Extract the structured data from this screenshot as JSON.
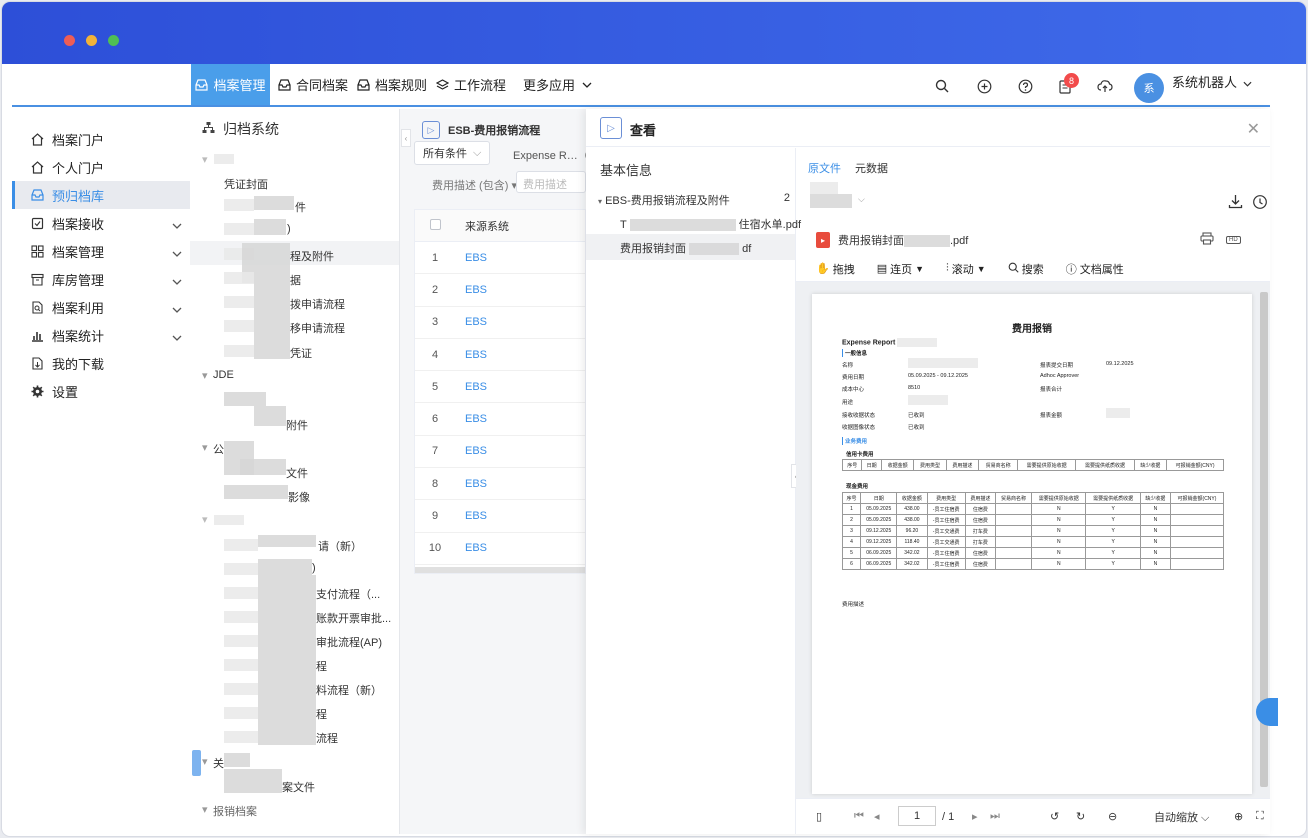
{
  "nav": {
    "items": [
      {
        "label": "档案管理",
        "icon": "inbox-icon",
        "active": true
      },
      {
        "label": "合同档案",
        "icon": "inbox-icon",
        "active": false
      },
      {
        "label": "档案规则",
        "icon": "inbox-icon",
        "active": false
      },
      {
        "label": "工作流程",
        "icon": "layers-icon",
        "active": false
      },
      {
        "label": "更多应用",
        "icon": "chevron-down-icon",
        "active": false
      }
    ],
    "badge_count": "8",
    "avatar_text": "系",
    "username": "系统机器人"
  },
  "sidebar": {
    "items": [
      {
        "label": "档案门户",
        "icon": "home-icon"
      },
      {
        "label": "个人门户",
        "icon": "home-icon"
      },
      {
        "label": "预归档库",
        "icon": "inbox-icon"
      },
      {
        "label": "档案接收",
        "icon": "receive-icon"
      },
      {
        "label": "档案管理",
        "icon": "grid-icon"
      },
      {
        "label": "库房管理",
        "icon": "archive-icon"
      },
      {
        "label": "档案利用",
        "icon": "file-search-icon"
      },
      {
        "label": "档案统计",
        "icon": "bar-chart-icon"
      },
      {
        "label": "我的下载",
        "icon": "download-icon"
      },
      {
        "label": "设置",
        "icon": "gear-icon"
      }
    ]
  },
  "tree": {
    "title": "归档系统",
    "nodes": [
      {
        "text": "凭证封面"
      },
      {
        "text": "件"
      },
      {
        "text": ")"
      },
      {
        "text": "程及附件"
      },
      {
        "text": "据"
      },
      {
        "text": "拨申请流程"
      },
      {
        "text": "移申请流程"
      },
      {
        "text": "凭证"
      },
      {
        "text": "JDE"
      },
      {
        "text": "附件"
      },
      {
        "text": "公"
      },
      {
        "text": "文件"
      },
      {
        "text": "影像"
      },
      {
        "text": "请（新）"
      },
      {
        "text": ")"
      },
      {
        "text": "支付流程（..."
      },
      {
        "text": "账款开票审批..."
      },
      {
        "text": "审批流程(AP)"
      },
      {
        "text": "程"
      },
      {
        "text": "料流程（新）"
      },
      {
        "text": "程"
      },
      {
        "text": "流程"
      },
      {
        "text": "关"
      },
      {
        "text": "案文件"
      },
      {
        "text": "报销档案"
      }
    ]
  },
  "list": {
    "title": "ESB-费用报销流程",
    "filter_label": "所有条件",
    "filter_field": "Expense R…（包",
    "condition_label": "费用描述 (包含)",
    "condition_placeholder": "费用描述",
    "col_source": "来源系统",
    "rows": [
      {
        "num": "1",
        "source": "EBS"
      },
      {
        "num": "2",
        "source": "EBS"
      },
      {
        "num": "3",
        "source": "EBS"
      },
      {
        "num": "4",
        "source": "EBS"
      },
      {
        "num": "5",
        "source": "EBS"
      },
      {
        "num": "6",
        "source": "EBS"
      },
      {
        "num": "7",
        "source": "EBS"
      },
      {
        "num": "8",
        "source": "EBS"
      },
      {
        "num": "9",
        "source": "EBS"
      },
      {
        "num": "10",
        "source": "EBS"
      }
    ]
  },
  "view": {
    "title": "查看",
    "basic_info": "基本信息",
    "attach_group": "EBS-费用报销流程及附件",
    "attach_count": "2",
    "attach1_prefix": "T",
    "attach1_suffix": "住宿水单.pdf",
    "attach2_prefix": "费用报销封面",
    "attach2_suffix": "df",
    "tab_original": "原文件",
    "tab_meta": "元数据",
    "file_name_prefix": "费用报销封面",
    "file_name_suffix": ".pdf",
    "toolbar": {
      "drag": "拖拽",
      "page": "连页",
      "scroll": "滚动",
      "search": "搜索",
      "props": "文档属性"
    },
    "page_input": "1",
    "page_total": "/ 1",
    "zoom": "自动缩放"
  },
  "doc": {
    "title": "费用报销",
    "report_label": "Expense Report",
    "general": "一般信息",
    "name": "名称",
    "expense_date": "费用日期",
    "date_range": "05.09.2025 - 09.12.2025",
    "cost_center": "成本中心",
    "cost_center_val": "8510",
    "purpose": "用途",
    "receipt_status": "接收收据状态",
    "receipt_status_val": "已收到",
    "image_status": "收据图像状态",
    "image_status_val": "已收到",
    "submit_date": "报表提交日期",
    "submit_date_val": "09.12.2025",
    "approver": "Adhoc Approver",
    "report_total": "报表合计",
    "report_amount": "报表金额",
    "business_expense": "业务费用",
    "credit_card": "信用卡费用",
    "cash": "现金费用",
    "cc_headers": [
      "序号",
      "日期",
      "收据金额",
      "费用类型",
      "费用描述",
      "贸易商名称",
      "需要提供原始收据",
      "需要提供纸质收据",
      "缺少收据",
      "可报销金额(CNY)"
    ],
    "cash_headers": [
      "序号",
      "日期",
      "收据金额",
      "费用类型",
      "费用描述",
      "贸易商名称",
      "需要提供原始收据",
      "需要提供纸质收据",
      "缺少收据",
      "可报销金额(CNY)"
    ],
    "cash_rows": [
      {
        "n": "1",
        "date": "05.09.2025",
        "amt": "438.00",
        "type": "-员工住宿费",
        "desc": "住宿费",
        "a": "N",
        "b": "Y",
        "c": "N"
      },
      {
        "n": "2",
        "date": "05.09.2025",
        "amt": "438.00",
        "type": "-员工住宿费",
        "desc": "住宿费",
        "a": "N",
        "b": "Y",
        "c": "N"
      },
      {
        "n": "3",
        "date": "09.12.2025",
        "amt": "96.20",
        "type": "-员工交通费",
        "desc": "打车费",
        "a": "N",
        "b": "Y",
        "c": "N"
      },
      {
        "n": "4",
        "date": "09.12.2025",
        "amt": "118.40",
        "type": "-员工交通费",
        "desc": "打车费",
        "a": "N",
        "b": "Y",
        "c": "N"
      },
      {
        "n": "5",
        "date": "06.09.2025",
        "amt": "342.02",
        "type": "-员工住宿费",
        "desc": "住宿费",
        "a": "N",
        "b": "Y",
        "c": "N"
      },
      {
        "n": "6",
        "date": "06.09.2025",
        "amt": "342.02",
        "type": "-员工住宿费",
        "desc": "住宿费",
        "a": "N",
        "b": "Y",
        "c": "N"
      }
    ],
    "expense_desc": "费用描述"
  },
  "colors": {
    "titlebar": "#2d4fd8",
    "accent": "#3a8ee6",
    "nav_active": "#4a9eea",
    "badge": "#f24b4b",
    "pdf": "#e84c3d"
  }
}
